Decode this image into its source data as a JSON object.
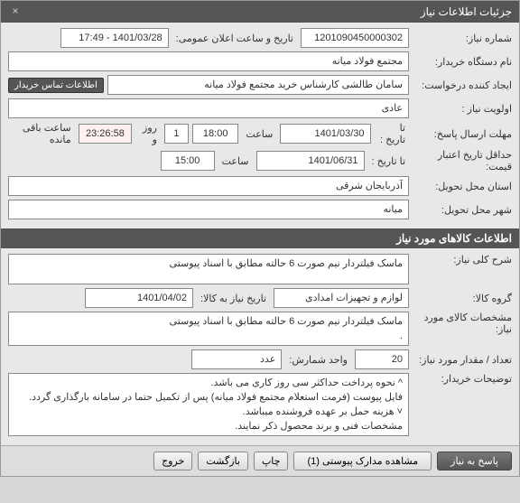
{
  "window": {
    "title": "جزئیات اطلاعات نیاز",
    "close": "×"
  },
  "need": {
    "number_label": "شماره نیاز:",
    "number": "1201090450000302",
    "announce_label": "تاریخ و ساعت اعلان عمومی:",
    "announce": "1401/03/28 - 17:49",
    "buyer_label": "نام دستگاه خریدار:",
    "buyer": "مجتمع فولاد میانه",
    "creator_label": "ایجاد کننده درخواست:",
    "creator": "سامان طالشی کارشناس خرید مجتمع فولاد میانه",
    "contact_btn": "اطلاعات تماس خریدار",
    "priority_label": "اولویت نیاز :",
    "priority": "عادی",
    "deadline_label": "مهلت ارسال پاسخ:",
    "to_date_label": "تا تاریخ :",
    "deadline_date": "1401/03/30",
    "time_label": "ساعت",
    "deadline_time": "18:00",
    "days_left": "1",
    "days_and": "روز و",
    "countdown": "23:26:58",
    "remaining": "ساعت باقی مانده",
    "validity_label": "حداقل تاریخ اعتبار قیمت:",
    "validity_date": "1401/06/31",
    "validity_time": "15:00",
    "province_label": "استان محل تحویل:",
    "province": "آذربایجان شرقی",
    "city_label": "شهر محل تحویل:",
    "city": "میانه"
  },
  "goods": {
    "header": "اطلاعات کالاهای مورد نیاز",
    "desc_label": "شرح کلی نیاز:",
    "desc": "ماسک فیلتردار نیم صورت 6 حالته مطابق با اسناد پیوستی",
    "group_label": "گروه کالا:",
    "group": "لوازم و تجهیزات امدادی",
    "need_date_label": "تاریخ نیاز به کالا:",
    "need_date": "1401/04/02",
    "spec_label": "مشخصات کالای مورد نیاز:",
    "spec": "ماسک فیلتردار نیم صورت 6 حالته مطابق با اسناد پیوستی\n.",
    "qty_label": "تعداد / مقدار مورد نیاز:",
    "qty": "20",
    "unit_label": "واحد شمارش:",
    "unit": "عدد",
    "notes_label": "توضیحات خریدار:",
    "notes": "^ نحوه پرداخت حداکثر سی روز کاری می باشد.\nفایل پیوست (فرمت استعلام مجتمع فولاد میانه) پس از تکمیل حتما در سامانه بارگذاری گردد.\n˅ هزینه حمل بر عهده فروشنده میباشد.\nمشخصات فنی و برند محصول ذکر نمایند."
  },
  "buttons": {
    "reply": "پاسخ به نیاز",
    "attachments": "مشاهده مدارک پیوستی (1)",
    "print": "چاپ",
    "back": "بازگشت",
    "exit": "خروج"
  }
}
